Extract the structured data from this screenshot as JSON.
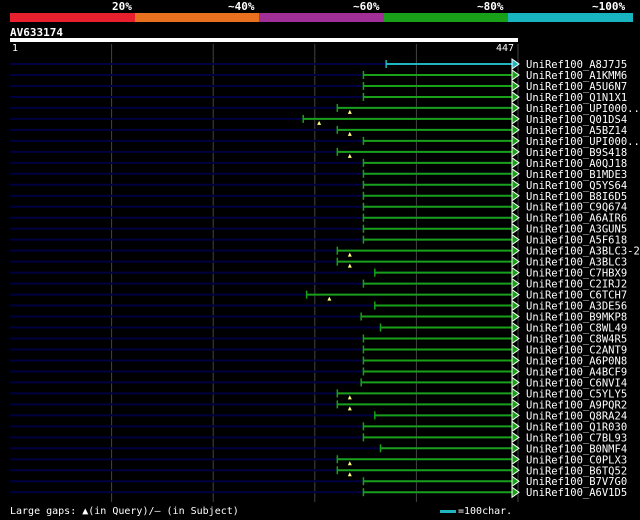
{
  "legend": {
    "segments": [
      {
        "color": "#e8202e"
      },
      {
        "color": "#e8701e"
      },
      {
        "color": "#a03098"
      },
      {
        "color": "#18a018"
      },
      {
        "color": "#18b4c0"
      }
    ],
    "labels": [
      "20%",
      "~40%",
      "~60%",
      "~80%",
      "~100%"
    ]
  },
  "query": {
    "name": "AV633174",
    "start_label": "1",
    "end_label": "447",
    "length": 447
  },
  "hits": [
    {
      "name": "UniRef100_A8J7J5",
      "start": 331,
      "color": "#1fb4c0",
      "marker": null
    },
    {
      "name": "UniRef100_A1KMM6",
      "start": 311,
      "color": "#18a018",
      "marker": null
    },
    {
      "name": "UniRef100_A5U6N7",
      "start": 311,
      "color": "#18a018",
      "marker": null
    },
    {
      "name": "UniRef100_Q1N1X1",
      "start": 311,
      "color": "#18a018",
      "marker": null
    },
    {
      "name": "UniRef100_UPI000..",
      "start": 288,
      "color": "#18a018",
      "marker": 299
    },
    {
      "name": "UniRef100_Q01DS4",
      "start": 258,
      "color": "#18a018",
      "marker": 272
    },
    {
      "name": "UniRef100_A5BZ14",
      "start": 288,
      "color": "#18a018",
      "marker": 299
    },
    {
      "name": "UniRef100_UPI000..",
      "start": 311,
      "color": "#18a018",
      "marker": null
    },
    {
      "name": "UniRef100_B9S418",
      "start": 288,
      "color": "#18a018",
      "marker": 299
    },
    {
      "name": "UniRef100_A0QJ18",
      "start": 311,
      "color": "#18a018",
      "marker": null
    },
    {
      "name": "UniRef100_B1MDE3",
      "start": 311,
      "color": "#18a018",
      "marker": null
    },
    {
      "name": "UniRef100_Q5YS64",
      "start": 311,
      "color": "#18a018",
      "marker": null
    },
    {
      "name": "UniRef100_B8I6D5",
      "start": 311,
      "color": "#18a018",
      "marker": null
    },
    {
      "name": "UniRef100_C9Q674",
      "start": 311,
      "color": "#18a018",
      "marker": null
    },
    {
      "name": "UniRef100_A6AIR6",
      "start": 311,
      "color": "#18a018",
      "marker": null
    },
    {
      "name": "UniRef100_A3GUN5",
      "start": 311,
      "color": "#18a018",
      "marker": null
    },
    {
      "name": "UniRef100_A5F618",
      "start": 311,
      "color": "#18a018",
      "marker": null
    },
    {
      "name": "UniRef100_A3BLC3-2",
      "start": 288,
      "color": "#18a018",
      "marker": 299
    },
    {
      "name": "UniRef100_A3BLC3",
      "start": 288,
      "color": "#18a018",
      "marker": 299
    },
    {
      "name": "UniRef100_C7HBX9",
      "start": 321,
      "color": "#18a018",
      "marker": null
    },
    {
      "name": "UniRef100_C2IRJ2",
      "start": 311,
      "color": "#18a018",
      "marker": null
    },
    {
      "name": "UniRef100_C6TCH7",
      "start": 261,
      "color": "#18a018",
      "marker": 281
    },
    {
      "name": "UniRef100_A3DE56",
      "start": 321,
      "color": "#18a018",
      "marker": null
    },
    {
      "name": "UniRef100_B9MKP8",
      "start": 309,
      "color": "#18a018",
      "marker": null
    },
    {
      "name": "UniRef100_C8WL49",
      "start": 326,
      "color": "#18a018",
      "marker": null
    },
    {
      "name": "UniRef100_C8W4R5",
      "start": 311,
      "color": "#18a018",
      "marker": null
    },
    {
      "name": "UniRef100_C2ANT9",
      "start": 311,
      "color": "#18a018",
      "marker": null
    },
    {
      "name": "UniRef100_A6P0N8",
      "start": 311,
      "color": "#18a018",
      "marker": null
    },
    {
      "name": "UniRef100_A4BCF9",
      "start": 311,
      "color": "#18a018",
      "marker": null
    },
    {
      "name": "UniRef100_C6NVI4",
      "start": 309,
      "color": "#18a018",
      "marker": null
    },
    {
      "name": "UniRef100_C5YLY5",
      "start": 288,
      "color": "#18a018",
      "marker": 299
    },
    {
      "name": "UniRef100_A9PQR2",
      "start": 288,
      "color": "#18a018",
      "marker": 299
    },
    {
      "name": "UniRef100_Q8RA24",
      "start": 321,
      "color": "#18a018",
      "marker": null
    },
    {
      "name": "UniRef100_Q1R030",
      "start": 311,
      "color": "#18a018",
      "marker": null
    },
    {
      "name": "UniRef100_C7BL93",
      "start": 311,
      "color": "#18a018",
      "marker": null
    },
    {
      "name": "UniRef100_B0NMF4",
      "start": 326,
      "color": "#18a018",
      "marker": null
    },
    {
      "name": "UniRef100_C0PLX3",
      "start": 288,
      "color": "#18a018",
      "marker": 299
    },
    {
      "name": "UniRef100_B6TQ52",
      "start": 288,
      "color": "#18a018",
      "marker": 299
    },
    {
      "name": "UniRef100_B7V7G0",
      "start": 311,
      "color": "#18a018",
      "marker": null
    },
    {
      "name": "UniRef100_A6V1D5",
      "start": 311,
      "color": "#18a018",
      "marker": null
    }
  ],
  "footer": {
    "gaps_text": "Large gaps: ▲(in Query)/— (in Subject)",
    "scale_text": "=100char."
  },
  "colors": {
    "query_line": "#000040",
    "grid": "#444444",
    "arrow_outline": "#ffffff",
    "marker": "#ffff80"
  }
}
